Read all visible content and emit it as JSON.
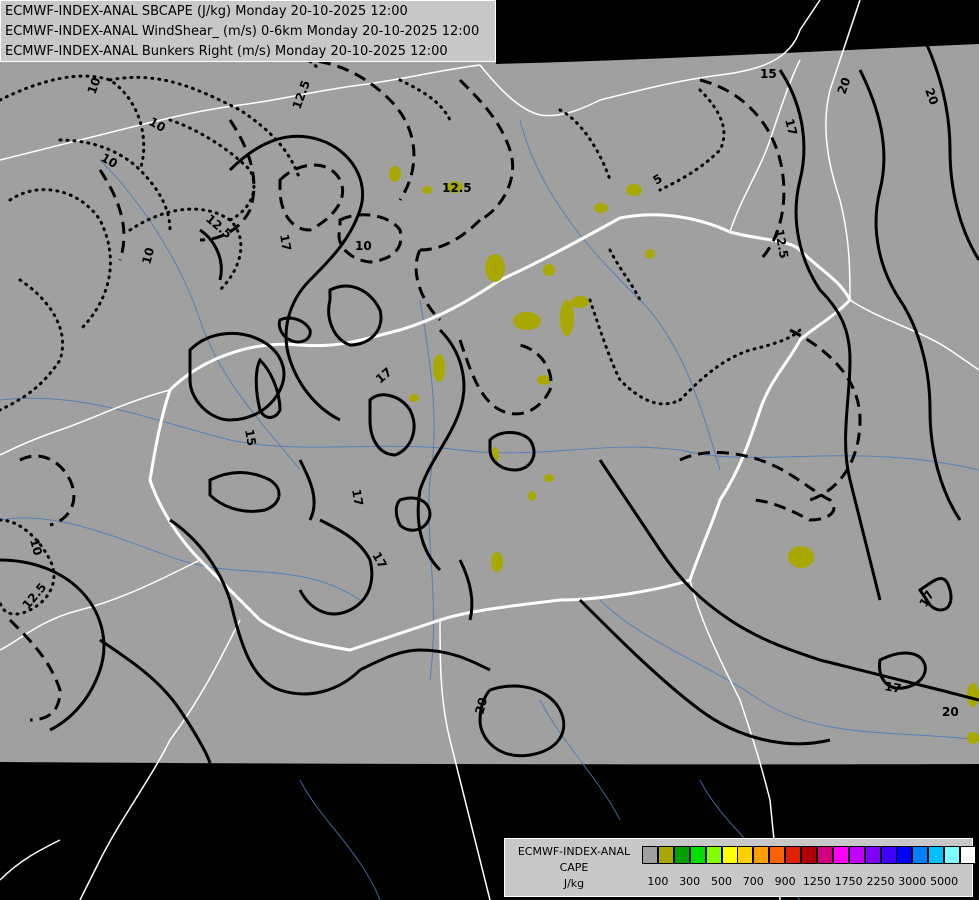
{
  "titles": [
    "ECMWF-INDEX-ANAL SBCAPE (J/kg) Monday 20-10-2025 12:00",
    "ECMWF-INDEX-ANAL WindShear_ (m/s) 0-6km Monday 20-10-2025 12:00",
    "ECMWF-INDEX-ANAL Bunkers Right (m/s) Monday 20-10-2025 12:00"
  ],
  "legend": {
    "line1": "ECMWF-INDEX-ANAL",
    "line2": "CAPE",
    "line3": "J/kg",
    "colors": [
      "#a0a0a0",
      "#a8a800",
      "#00a000",
      "#00e000",
      "#80ff00",
      "#ffff00",
      "#ffd000",
      "#ffa000",
      "#ff6000",
      "#e02000",
      "#b00000",
      "#d00080",
      "#ff00ff",
      "#c000ff",
      "#8000ff",
      "#4000ff",
      "#0000ff",
      "#0080ff",
      "#00c0ff",
      "#80ffff",
      "#ffffff"
    ],
    "ticks": [
      "100",
      "300",
      "500",
      "700",
      "900",
      "1250",
      "1750",
      "2250",
      "3000",
      "5000"
    ]
  },
  "contour_labels": {
    "l1": "10",
    "l2": "12.5",
    "l3": "10",
    "l4": "10",
    "l5": "12.5",
    "l6": "10",
    "l7": "12.5",
    "l8": "10",
    "l9": "5",
    "l10": "15",
    "l11": "20",
    "l12": "20",
    "l13": "17",
    "l14": "12.5",
    "l15": "17",
    "l16": "15",
    "l17": "17",
    "l18": "17",
    "l19": "17",
    "l20": "10",
    "l21": "12.5",
    "l22": "20",
    "l23": "17",
    "l24": "20",
    "l25": "17"
  }
}
